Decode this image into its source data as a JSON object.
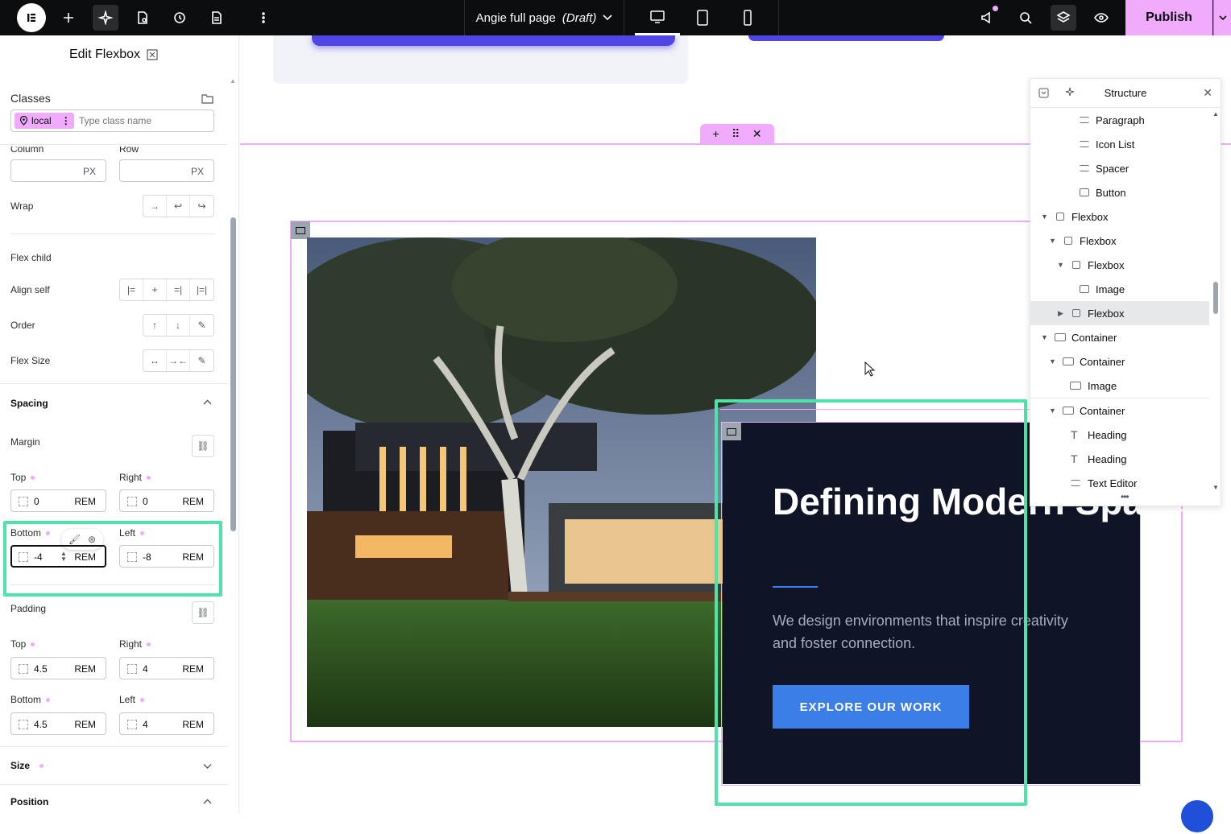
{
  "topbar": {
    "page_name": "Angie full page",
    "page_status": "(Draft)",
    "publish_label": "Publish"
  },
  "panel": {
    "title": "Edit Flexbox",
    "classes_label": "Classes",
    "class_chip": "local",
    "class_placeholder": "Type class name",
    "column_label": "Column",
    "row_label": "Row",
    "px_unit": "PX",
    "wrap_label": "Wrap",
    "flex_child_label": "Flex child",
    "align_self_label": "Align self",
    "order_label": "Order",
    "flex_size_label": "Flex Size",
    "spacing_label": "Spacing",
    "margin_label": "Margin",
    "margin": {
      "top_label": "Top",
      "top_value": "0",
      "right_label": "Right",
      "right_value": "0",
      "bottom_label": "Bottom",
      "bottom_value": "-4",
      "left_label": "Left",
      "left_value": "-8"
    },
    "padding_label": "Padding",
    "padding": {
      "top_label": "Top",
      "top_value": "4.5",
      "right_label": "Right",
      "right_value": "4",
      "bottom_label": "Bottom",
      "bottom_value": "4.5",
      "left_label": "Left",
      "left_value": "4"
    },
    "unit": "REM",
    "size_label": "Size",
    "position_label": "Position"
  },
  "canvas": {
    "hero_title": "Defining Modern Spaces",
    "hero_desc": "We design environments that inspire creativity and foster connection.",
    "cta_label": "EXPLORE OUR WORK"
  },
  "structure": {
    "title": "Structure",
    "items": [
      {
        "label": "Paragraph"
      },
      {
        "label": "Icon List"
      },
      {
        "label": "Spacer"
      },
      {
        "label": "Button"
      },
      {
        "label": "Flexbox"
      },
      {
        "label": "Flexbox"
      },
      {
        "label": "Flexbox"
      },
      {
        "label": "Image"
      },
      {
        "label": "Flexbox"
      },
      {
        "label": "Container"
      },
      {
        "label": "Container"
      },
      {
        "label": "Image"
      },
      {
        "label": "Container"
      },
      {
        "label": "Heading"
      },
      {
        "label": "Heading"
      },
      {
        "label": "Text Editor"
      }
    ]
  },
  "colors": {
    "accent_pink": "#f0abfc",
    "highlight_green": "#4ee3a7",
    "cta_blue": "#3b7ee8",
    "hero_bg": "#0f1426"
  }
}
